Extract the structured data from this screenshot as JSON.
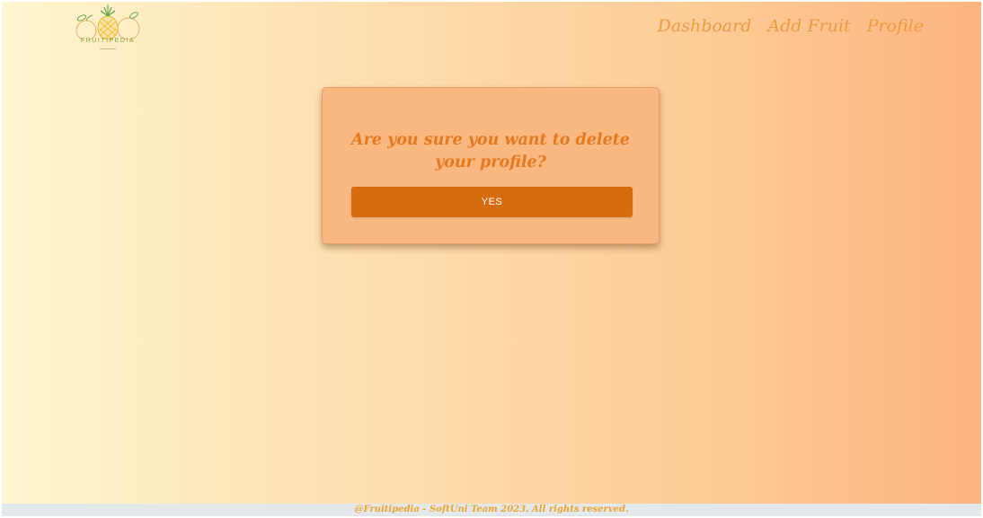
{
  "brand": {
    "logo_text": "FRUITIPEDIA",
    "logo_icon": "fruit-basket-logo-icon"
  },
  "nav": {
    "items": [
      {
        "label": "Dashboard"
      },
      {
        "label": "Add Fruit"
      },
      {
        "label": "Profile"
      }
    ]
  },
  "dialog": {
    "title": "Are you sure you want to delete your profile?",
    "confirm_label": "YES"
  },
  "footer": {
    "text": "@Fruitipedia - SoftUni Team 2023. All rights reserved."
  },
  "colors": {
    "accent": "#d66b0f",
    "heading": "#e8781c",
    "nav_link": "#ee9a3f",
    "dialog_bg": "#f8b880",
    "footer_text": "#f0a32a",
    "footer_bg": "#e3e8ea"
  }
}
